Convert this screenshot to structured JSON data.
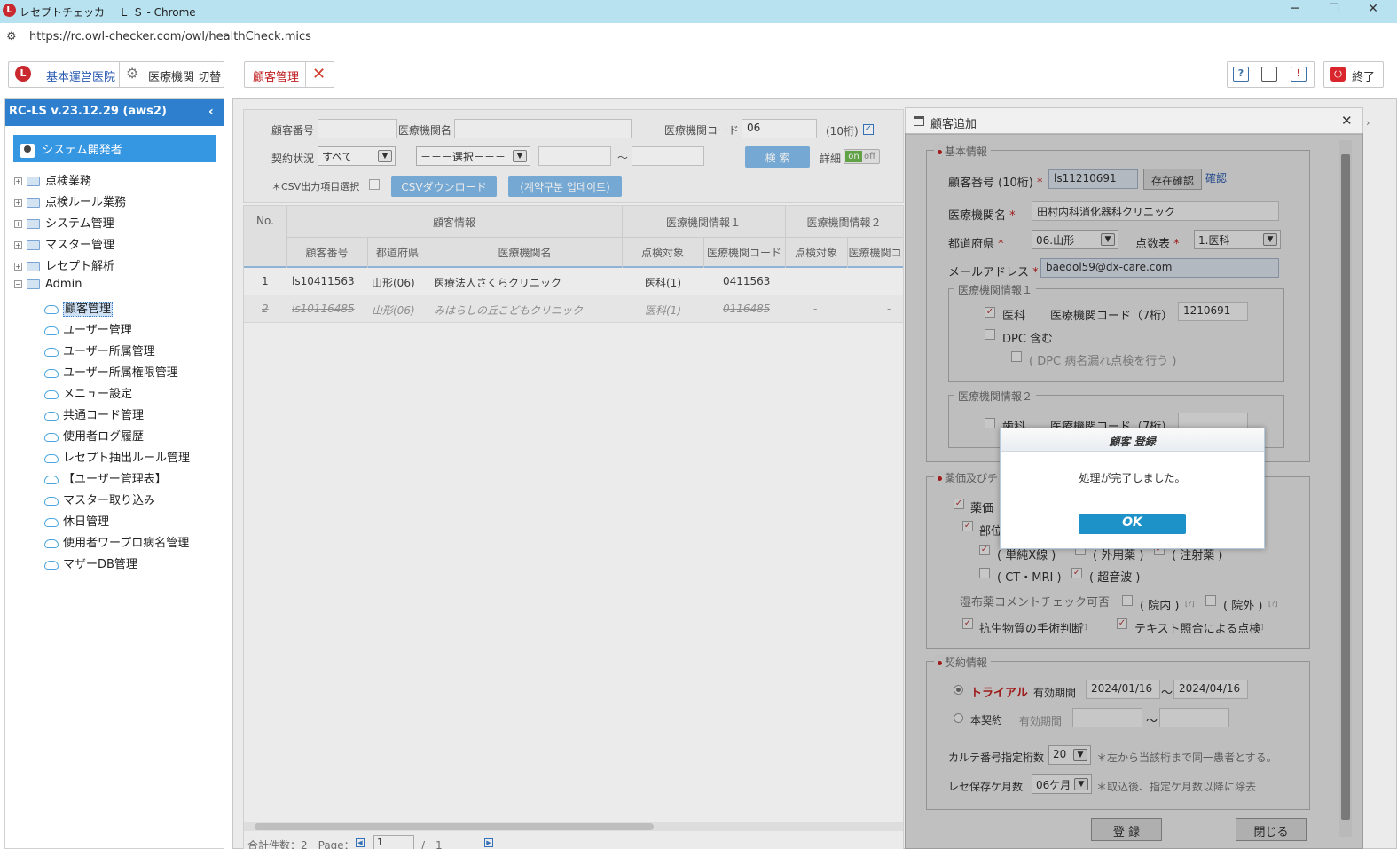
{
  "browser": {
    "title": "レセプトチェッカー Ｌ Ｓ - Chrome",
    "url": "https://rc.owl-checker.com/owl/healthCheck.mics"
  },
  "toolbar": {
    "hospital_label": "基本運営医院",
    "switch_label": "医療機関 切替",
    "tab_label": "顧客管理",
    "exit_label": "終了"
  },
  "sidebar": {
    "version": "RC-LS v.23.12.29 (aws2)",
    "user": "システム開発者",
    "folders": [
      {
        "label": "点検業務",
        "expander": "+"
      },
      {
        "label": "点検ルール業務",
        "expander": "+"
      },
      {
        "label": "システム管理",
        "expander": "+"
      },
      {
        "label": "マスター管理",
        "expander": "+"
      },
      {
        "label": "レセプト解析",
        "expander": "+"
      },
      {
        "label": "Admin",
        "expander": "−"
      }
    ],
    "admin_items": [
      "顧客管理",
      "ユーザー管理",
      "ユーザー所属管理",
      "ユーザー所属権限管理",
      "メニュー設定",
      "共通コード管理",
      "使用者ログ履歴",
      "レセプト抽出ルール管理",
      "【ユーザー管理表】",
      "マスター取り込み",
      "休日管理",
      "使用者ワープロ病名管理",
      "マザーDB管理"
    ]
  },
  "search": {
    "customer_no_label": "顧客番号",
    "facility_name_label": "医療機関名",
    "facility_code_label": "医療機関コード",
    "facility_code_value": "06",
    "digits_note": "(10桁)",
    "contract_label": "契約状況",
    "contract_value": "すべて",
    "select_placeholder": "－－－選択－－－",
    "tilde": "～",
    "search_button": "検 索",
    "detail_label": "詳細",
    "toggle_on": "on",
    "toggle_off": "off",
    "csv_item_label": "＊CSV出力項目選択",
    "csv_button": "CSVダウンロード",
    "contract_update_button": "(계약구분 업데이트)"
  },
  "table": {
    "group_headers": [
      "No.",
      "顧客情報",
      "医療機関情報１",
      "医療機関情報２"
    ],
    "sub_headers": [
      "顧客番号",
      "都道府県",
      "医療機関名",
      "点検対象",
      "医療機関コード",
      "点検対象",
      "医療機関コ"
    ],
    "rows": [
      {
        "no": "1",
        "customer_no": "ls10411563",
        "pref": "山形(06)",
        "name": "医療法人さくらクリニック",
        "target1": "医科(1)",
        "code1": "0411563",
        "target2": "",
        "code2": ""
      },
      {
        "no": "2",
        "customer_no": "ls10116485",
        "pref": "山形(06)",
        "name": "みはらしの丘こどもクリニック",
        "target1": "医科(1)",
        "code1": "0116485",
        "target2": "-",
        "code2": "-"
      }
    ],
    "footer": "合計件数：2　Page：",
    "page_value": "1",
    "page_total": "/　1"
  },
  "dialog": {
    "title": "顧客追加",
    "basic_legend": "基本情報",
    "customer_no_label": "顧客番号 (10桁)",
    "customer_no_value": "ls11210691",
    "exist_check_button": "存在確認",
    "confirm_link": "確認",
    "facility_name_label": "医療機関名",
    "facility_name_value": "田村内科消化器科クリニック",
    "pref_label": "都道府県",
    "pref_value": "06.山形",
    "score_label": "点数表",
    "score_value": "1.医科",
    "email_label": "メールアドレス",
    "email_value": "baedol59@dx-care.com",
    "fac1_legend": "医療機関情報１",
    "fac1_type": "医科",
    "fac1_code_label": "医療機関コード（7桁）",
    "fac1_code_value": "1210691",
    "dpc_label": "DPC 含む",
    "dpc_sub_label": "( DPC 病名漏れ点検を行う )",
    "fac2_legend": "医療機関情報２",
    "fac2_type": "歯科",
    "fac2_code_label": "医療機関コード（7桁）",
    "drug_legend": "薬価及びチ",
    "drug_item": "薬価",
    "part_item": "部位",
    "simple_xray": "( 単純X線 )",
    "external": "( 外用薬 )",
    "injection": "( 注射薬 )",
    "ct_mri": "( CT・MRI )",
    "ultrasound": "( 超音波 )",
    "compress_label": "湿布薬コメントチェック可否",
    "inhouse": "( 院内 )",
    "outside": "( 院外 )",
    "help_mark": "[?]",
    "antibiotic_label": "抗生物質の手術判断",
    "text_match_label": "テキスト照合による点検",
    "contract_legend": "契約情報",
    "trial_label": "トライアル",
    "valid_period_label": "有効期間",
    "trial_from": "2024/01/16",
    "trial_to": "2024/04/16",
    "tilde": "～",
    "main_contract_label": "本契約",
    "karte_label": "カルテ番号指定桁数",
    "karte_value": "20",
    "karte_note": "＊左から当該桁まで同一患者とする。",
    "retention_label": "レセ保存ケ月数",
    "retention_value": "06ケ月",
    "retention_note": "＊取込後、指定ケ月数以降に除去",
    "register_button": "登 録",
    "close_button": "閉じる"
  },
  "message_box": {
    "title": "顧客 登録",
    "message": "処理が完了しました。",
    "ok_button": "OK"
  },
  "colors": {
    "accent_blue": "#2e80cf",
    "user_bar": "#3596e1",
    "ok_button": "#1d92c8",
    "required_red": "#cc2222"
  }
}
